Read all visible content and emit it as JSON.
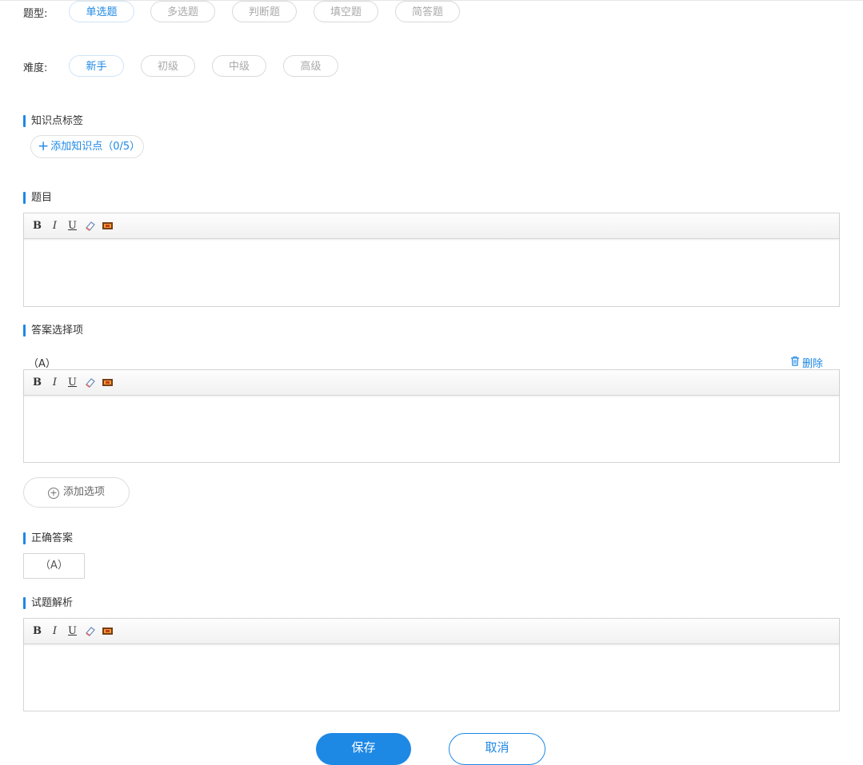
{
  "question_type": {
    "label": "题型:",
    "options": [
      "单选题",
      "多选题",
      "判断题",
      "填空题",
      "简答题"
    ],
    "selected": "单选题"
  },
  "difficulty": {
    "label": "难度:",
    "options": [
      "新手",
      "初级",
      "中级",
      "高级"
    ],
    "selected": "新手"
  },
  "knowledge": {
    "title": "知识点标签",
    "add_label": "添加知识点（0/5）",
    "plus_icon": "+"
  },
  "question": {
    "title": "题目"
  },
  "toolbar": {
    "bold": "B",
    "italic": "I",
    "underline": "U"
  },
  "answers": {
    "title": "答案选择项",
    "option_label": "（A）",
    "delete_label": "删除",
    "add_label": "添加选项",
    "add_icon": "+"
  },
  "correct": {
    "title": "正确答案",
    "value": "（A）"
  },
  "analysis": {
    "title": "试题解析"
  },
  "actions": {
    "save": "保存",
    "cancel": "取消"
  },
  "colors": {
    "accent": "#1e88e5",
    "border": "#d5d5d5"
  }
}
